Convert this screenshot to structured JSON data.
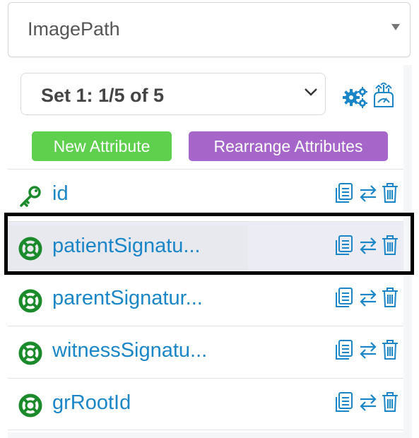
{
  "top_select": {
    "value": "ImagePath"
  },
  "set_select": {
    "value": "Set 1: 1/5 of 5"
  },
  "buttons": {
    "new_attribute": "New Attribute",
    "rearrange_attributes": "Rearrange Attributes"
  },
  "colors": {
    "link_blue": "#1a86c8",
    "icon_blue": "#1a86c8",
    "green": "#1b8a2a",
    "new_btn": "#5fcf4e",
    "rearrange_btn": "#a665c8"
  },
  "attributes": [
    {
      "name": "id",
      "icon": "key-icon"
    },
    {
      "name": "patientSignatu...",
      "icon": "lifebuoy-icon",
      "selected": true
    },
    {
      "name": "parentSignatur...",
      "icon": "lifebuoy-icon"
    },
    {
      "name": "witnessSignatu...",
      "icon": "lifebuoy-icon"
    },
    {
      "name": "grRootId",
      "icon": "lifebuoy-icon"
    }
  ],
  "row_actions": [
    "document-icon",
    "swap-icon",
    "trash-icon"
  ]
}
